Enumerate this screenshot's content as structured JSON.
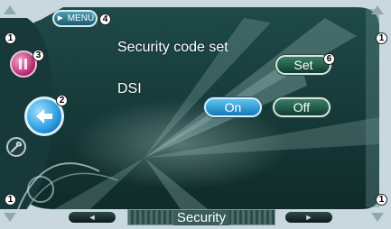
{
  "menu": {
    "label": "MENU",
    "arrow": "►"
  },
  "screen": {
    "security_code_label": "Security code set",
    "set_button": "Set",
    "dsi_label": "DSI",
    "on_button": "On",
    "off_button": "Off",
    "title": "Security"
  },
  "nav": {
    "prev": "◄",
    "next": "►"
  },
  "markers": {
    "m1": "1",
    "m2": "2",
    "m3": "3",
    "m4": "4",
    "m6": "6"
  },
  "colors": {
    "panel": "#143d3d",
    "accent_blue": "#2b9be0",
    "accent_green": "#2a6b55"
  }
}
